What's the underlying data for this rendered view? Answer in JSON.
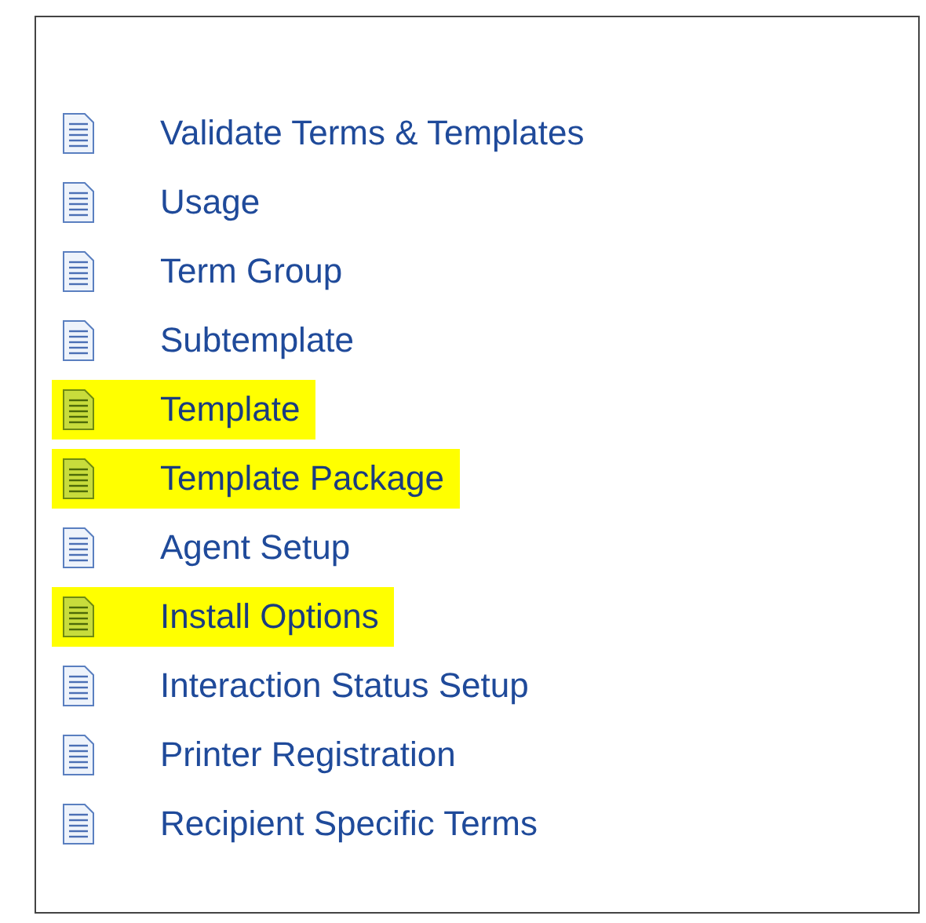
{
  "items": [
    {
      "label": "Validate Terms & Templates",
      "highlighted": false
    },
    {
      "label": "Usage",
      "highlighted": false
    },
    {
      "label": "Term Group",
      "highlighted": false
    },
    {
      "label": "Subtemplate",
      "highlighted": false
    },
    {
      "label": "Template",
      "highlighted": true
    },
    {
      "label": "Template Package",
      "highlighted": true
    },
    {
      "label": "Agent Setup",
      "highlighted": false
    },
    {
      "label": "Install Options",
      "highlighted": true
    },
    {
      "label": "Interaction Status Setup",
      "highlighted": false
    },
    {
      "label": "Printer Registration",
      "highlighted": false
    },
    {
      "label": "Recipient Specific Terms",
      "highlighted": false
    }
  ]
}
